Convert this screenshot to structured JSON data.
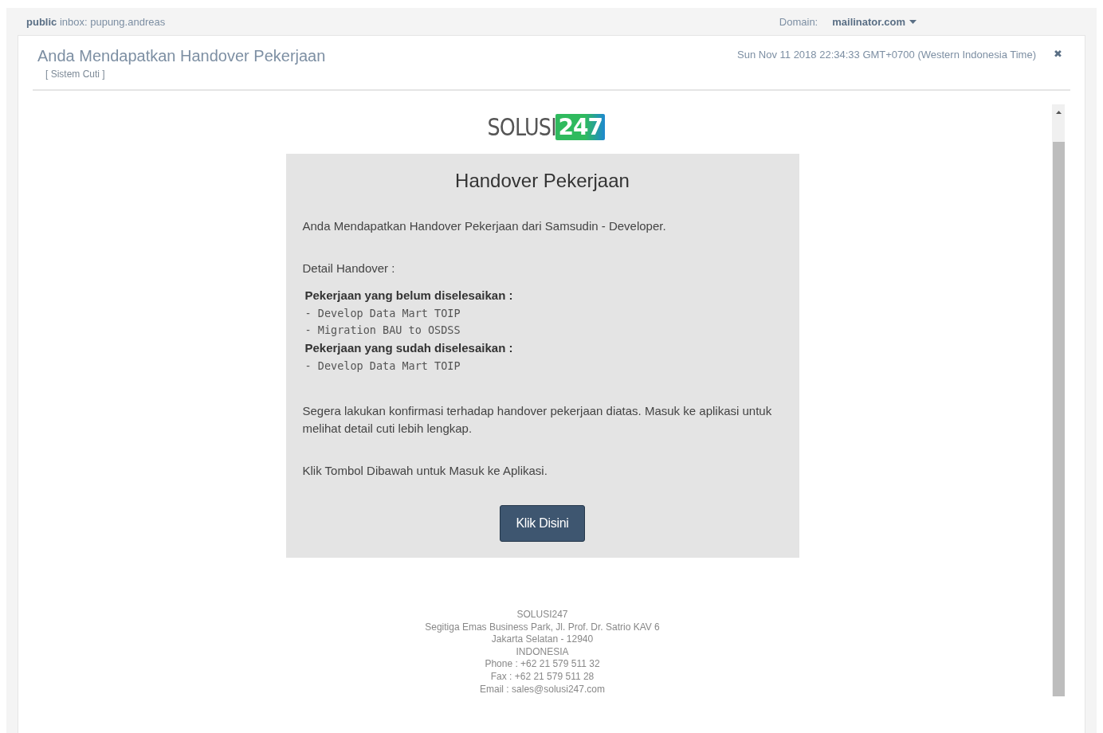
{
  "top_bar": {
    "visibility": "public",
    "inbox": "inbox: pupung.andreas",
    "domain_label": "Domain:",
    "domain": "mailinator.com"
  },
  "message": {
    "subject": "Anda Mendapatkan Handover Pekerjaan",
    "from": "[ Sistem Cuti ]",
    "date": "Sun Nov 11 2018 22:34:33 GMT+0700 (Western Indonesia Time)",
    "close": "✖"
  },
  "email": {
    "logo": {
      "word": "SOLUSI",
      "number": "247"
    },
    "heading": "Handover Pekerjaan",
    "intro": "Anda Mendapatkan Handover Pekerjaan dari Samsudin - Developer.",
    "detail_label": "Detail Handover :",
    "sections": [
      {
        "title": "Pekerjaan yang belum diselesaikan :",
        "items": [
          "- Develop Data Mart TOIP",
          "- Migration BAU to OSDSS"
        ]
      },
      {
        "title": "Pekerjaan yang sudah diselesaikan :",
        "items": [
          "- Develop Data Mart TOIP"
        ]
      }
    ],
    "paragraphs": [
      "Segera lakukan konfirmasi terhadap handover pekerjaan diatas. Masuk ke aplikasi untuk melihat detail cuti lebih lengkap.",
      "Klik Tombol Dibawah untuk Masuk ke Aplikasi."
    ],
    "button": "Klik Disini",
    "footer": [
      "SOLUSI247",
      "Segitiga Emas Business Park, Jl. Prof. Dr. Satrio KAV 6",
      "Jakarta Selatan - 12940",
      "INDONESIA",
      "Phone : +62 21 579 511 32",
      "Fax : +62 21 579 511 28",
      "Email : sales@solusi247.com"
    ]
  }
}
